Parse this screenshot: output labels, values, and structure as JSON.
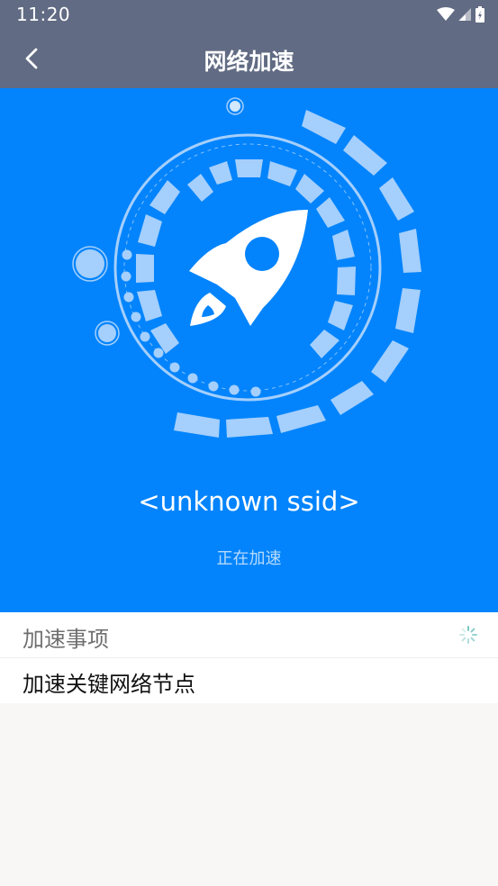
{
  "status_bar": {
    "time": "11:20",
    "icons": [
      "wifi-icon",
      "signal-icon",
      "battery-icon"
    ]
  },
  "app_bar": {
    "title": "网络加速",
    "back_icon": "chevron-left-icon"
  },
  "hero": {
    "ssid": "<unknown ssid>",
    "status": "正在加速",
    "icon": "rocket-icon"
  },
  "tasks": {
    "header": "加速事项",
    "items": [
      {
        "label": "加速关键网络节点"
      }
    ]
  },
  "colors": {
    "app_bar": "#616b83",
    "hero_bg": "#0384fc",
    "ring": "#a5cffc",
    "accent_spinner": "#7cc7c4"
  }
}
